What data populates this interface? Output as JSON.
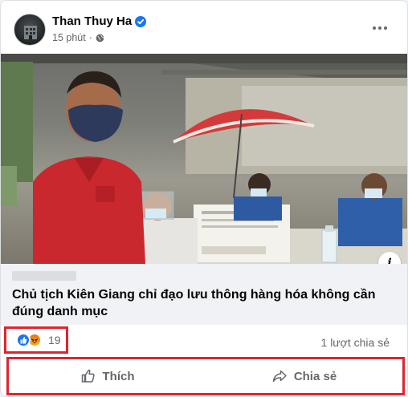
{
  "post": {
    "author": "Than Thuy Ha",
    "time": "15 phút",
    "privacy_icon": "globe-icon",
    "verified_icon": "verified-badge-icon",
    "more_icon": "more-options-icon"
  },
  "link": {
    "title": "Chủ tịch Kiên Giang chỉ đạo lưu thông hàng hóa không cần đúng danh mục",
    "info_label": "i"
  },
  "reactions": {
    "count": "19",
    "types": [
      "like-reaction-icon",
      "angry-reaction-icon"
    ],
    "shares": "1 lượt chia sẻ"
  },
  "actions": {
    "like_label": "Thích",
    "share_label": "Chia sẻ"
  },
  "colors": {
    "highlight": "#e0242f",
    "accent": "#1877f2",
    "muted_text": "#65676b"
  }
}
